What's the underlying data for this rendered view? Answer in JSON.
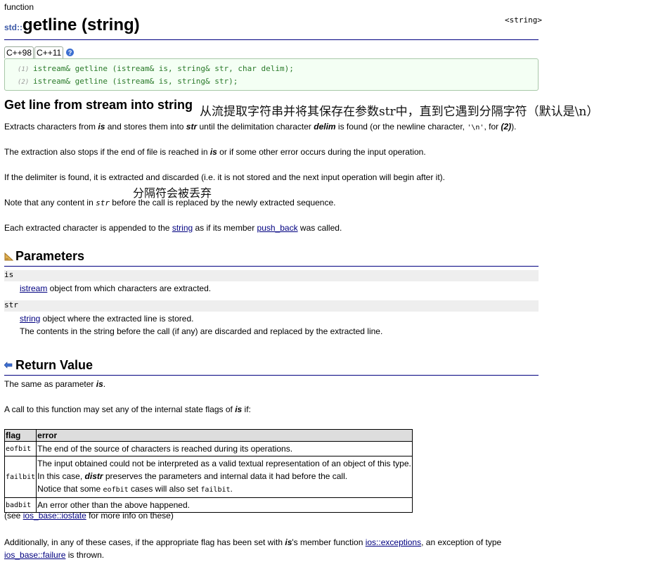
{
  "kind": "function",
  "title": {
    "ns": "std::",
    "name": "getline (string)"
  },
  "header_tag": "<string>",
  "versions": [
    "C++98",
    "C++11"
  ],
  "help_icon": "?",
  "prototypes": [
    {
      "num": "(1)",
      "code": "istream& getline (istream& is, string& str, char delim);"
    },
    {
      "num": "(2)",
      "code": "istream& getline (istream& is, string& str);"
    }
  ],
  "desc_heading": "Get line from stream into string",
  "notes": {
    "n1": "从流提取字符串并将其保存在参数str中，直到它遇到分隔字符（默认是\\n）",
    "n2": "分隔符会被丢弃"
  },
  "paragraphs": {
    "p1a": "Extracts characters from ",
    "p1b": "is",
    "p1c": " and stores them into ",
    "p1d": "str",
    "p1e": " until the delimitation character ",
    "p1f": "delim",
    "p1g": " is found (or the newline character, ",
    "p1h": "'\\n'",
    "p1i": ", for ",
    "p1j": "(2)",
    "p1k": ").",
    "p2a": "The extraction also stops if the end of file is reached in ",
    "p2b": "is",
    "p2c": " or if some other error occurs during the input operation.",
    "p3": "If the delimiter is found, it is extracted and discarded (i.e. it is not stored and the next input operation will begin after it).",
    "p4a": "Note that any content in ",
    "p4b": "str",
    "p4c": " before the call is replaced by the newly extracted sequence.",
    "p5a": "Each extracted character is appended to the ",
    "p5b": "string",
    "p5c": " as if its member ",
    "p5d": "push_back",
    "p5e": " was called."
  },
  "parameters": {
    "heading": "Parameters",
    "items": [
      {
        "name": "is",
        "link": "istream",
        "desc": " object from which characters are extracted."
      },
      {
        "name": "str",
        "link": "string",
        "desc": " object where the extracted line is stored.",
        "extra": "The contents in the string before the call (if any) are discarded and replaced by the extracted line."
      }
    ]
  },
  "return_value": {
    "heading": "Return Value",
    "r1a": "The same as parameter ",
    "r1b": "is",
    "r1c": ".",
    "r2a": "A call to this function may set any of the internal state flags of ",
    "r2b": "is",
    "r2c": " if:"
  },
  "flags_table": {
    "headers": [
      "flag",
      "error"
    ],
    "rows": [
      {
        "flag": "eofbit",
        "lines": [
          "The end of the source of characters is reached during its operations."
        ]
      },
      {
        "flag": "failbit",
        "lines": [
          "The input obtained could not be interpreted as a valid textual representation of an object of this type.",
          "In this case, ",
          "distr",
          " preserves the parameters and internal data it had before the call.",
          "Notice that some ",
          "eofbit",
          " cases will also set ",
          "failbit",
          "."
        ]
      },
      {
        "flag": "badbit",
        "lines": [
          "An error other than the above happened."
        ]
      }
    ]
  },
  "see_also": {
    "a": "(see ",
    "link": "ios_base::iostate",
    "b": " for more info on these)"
  },
  "final": {
    "a": "Additionally, in any of these cases, if the appropriate flag has been set with ",
    "b": "is",
    "c": "'s member function ",
    "link1": "ios::exceptions",
    "d": ", an exception of type",
    "link2": "ios_base::failure",
    "e": " is thrown."
  }
}
